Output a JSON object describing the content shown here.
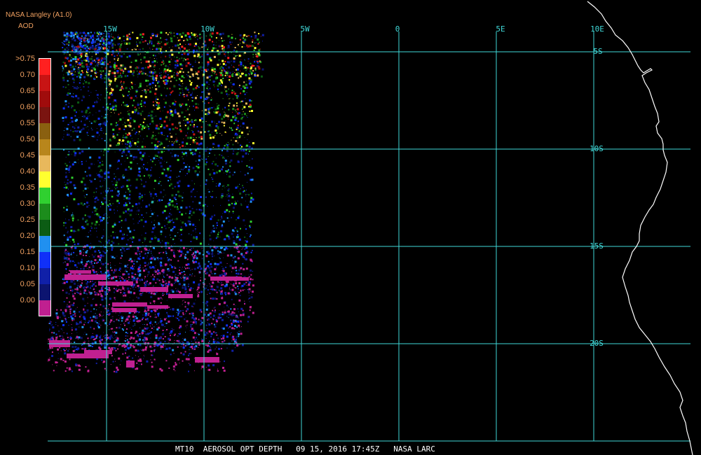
{
  "header": {
    "source": "NASA Langley (A1.0)",
    "variable": "AOD"
  },
  "colors": {
    "background": "#000000",
    "grid": "#40d8d8",
    "coastline": "#ffffff",
    "text_accent": "#f0a060"
  },
  "legend": {
    "entries": [
      {
        "label": ">0.75",
        "color": "#ff2020"
      },
      {
        "label": "0.70",
        "color": "#c81414"
      },
      {
        "label": "0.65",
        "color": "#a00c0c"
      },
      {
        "label": "0.60",
        "color": "#7a1410"
      },
      {
        "label": "0.55",
        "color": "#8a6010"
      },
      {
        "label": "0.50",
        "color": "#b8861c"
      },
      {
        "label": "0.45",
        "color": "#e8b85c"
      },
      {
        "label": "0.40",
        "color": "#ffff30"
      },
      {
        "label": "0.35",
        "color": "#30d030"
      },
      {
        "label": "0.30",
        "color": "#1c8c1c"
      },
      {
        "label": "0.25",
        "color": "#0c5c14"
      },
      {
        "label": "0.20",
        "color": "#2090f0"
      },
      {
        "label": "0.15",
        "color": "#1030f8"
      },
      {
        "label": "0.10",
        "color": "#1020a8"
      },
      {
        "label": "0.05",
        "color": "#0c1470"
      },
      {
        "label": "0.00",
        "color": "#c02090"
      }
    ]
  },
  "grid": {
    "lon_labels": [
      "15W",
      "10W",
      "5W",
      "0",
      "5E",
      "10E"
    ],
    "lat_labels": [
      "5S",
      "10S",
      "15S",
      "20S"
    ]
  },
  "footer": {
    "text": "MT10  AEROSOL OPT DEPTH   09 15, 2016 17:45Z   NASA LARC"
  }
}
